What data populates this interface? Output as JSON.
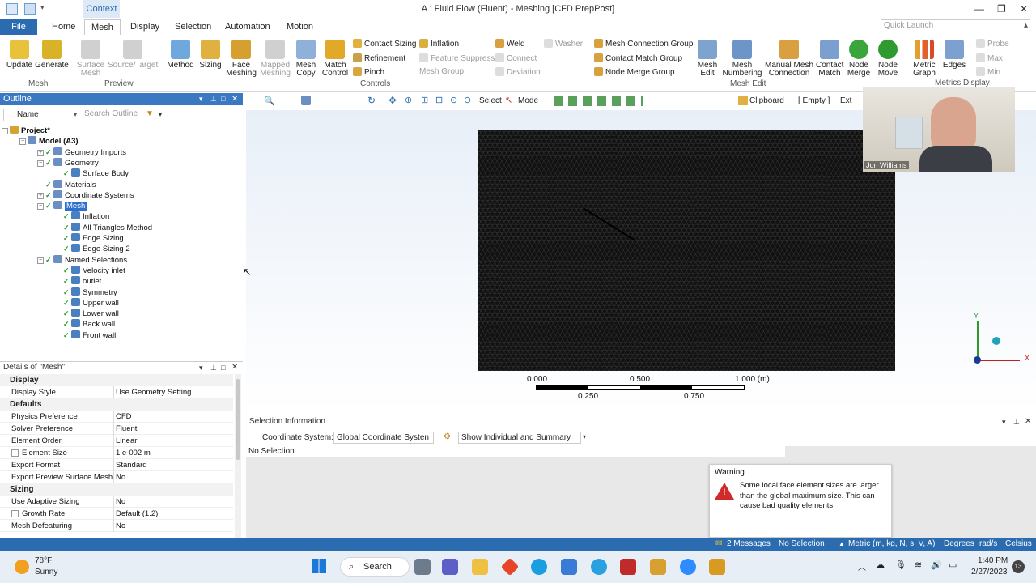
{
  "window": {
    "title": "A : Fluid Flow (Fluent) - Meshing [CFD PrepPost]",
    "context_tab": "Context"
  },
  "menu": {
    "tabs": [
      "File",
      "Home",
      "Mesh",
      "Display",
      "Selection",
      "Automation",
      "Motion"
    ],
    "quick_launch_placeholder": "Quick Launch"
  },
  "ribbon": {
    "mesh_group": {
      "label": "Mesh",
      "update": "Update",
      "generate": "Generate"
    },
    "preview_group": {
      "label": "Preview",
      "surface_mesh": "Surface Mesh",
      "source_target": "Source/Target"
    },
    "controls_group": {
      "label": "Controls",
      "method": "Method",
      "sizing": "Sizing",
      "face_meshing": "Face Meshing",
      "mapped_meshing": "Mapped Meshing",
      "mesh_copy": "Mesh Copy",
      "match_control": "Match Control",
      "contact_sizing": "Contact Sizing",
      "refinement": "Refinement",
      "pinch": "Pinch",
      "inflation": "Inflation",
      "feature_suppress": "Feature Suppress",
      "mesh_group": "Mesh Group",
      "weld": "Weld",
      "connect": "Connect",
      "deviation": "Deviation",
      "washer": "Washer"
    },
    "mesh_edit_group": {
      "label": "Mesh Edit",
      "mesh_connection_group": "Mesh Connection Group",
      "contact_match_group": "Contact Match Group",
      "node_merge_group": "Node Merge Group",
      "mesh_edit": "Mesh Edit",
      "mesh_numbering": "Mesh Numbering",
      "manual_mesh_connection": "Manual Mesh Connection",
      "contact_match": "Contact Match",
      "node_merge": "Node Merge",
      "node_move": "Node Move"
    },
    "metrics_group": {
      "label": "Metrics Display",
      "metric_graph": "Metric Graph",
      "edges": "Edges",
      "probe": "Probe",
      "max": "Max",
      "min": "Min"
    }
  },
  "outline": {
    "title": "Outline",
    "name_label": "Name",
    "search_placeholder": "Search Outline",
    "tree": [
      {
        "label": "Project*",
        "level": 0
      },
      {
        "label": "Model (A3)",
        "level": 1
      },
      {
        "label": "Geometry Imports",
        "level": 2
      },
      {
        "label": "Geometry",
        "level": 2
      },
      {
        "label": "Surface Body",
        "level": 3
      },
      {
        "label": "Materials",
        "level": 2
      },
      {
        "label": "Coordinate Systems",
        "level": 2
      },
      {
        "label": "Mesh",
        "level": 2,
        "selected": true
      },
      {
        "label": "Inflation",
        "level": 3
      },
      {
        "label": "All Triangles Method",
        "level": 3
      },
      {
        "label": "Edge Sizing",
        "level": 3
      },
      {
        "label": "Edge Sizing 2",
        "level": 3
      },
      {
        "label": "Named Selections",
        "level": 2
      },
      {
        "label": "Velocity inlet",
        "level": 3
      },
      {
        "label": "outlet",
        "level": 3
      },
      {
        "label": "Symmetry",
        "level": 3
      },
      {
        "label": "Upper wall",
        "level": 3
      },
      {
        "label": "Lower wall",
        "level": 3
      },
      {
        "label": "Back wall",
        "level": 3
      },
      {
        "label": "Front wall",
        "level": 3
      }
    ]
  },
  "details": {
    "title": "Details of \"Mesh\"",
    "rows": [
      {
        "type": "section",
        "label": "Display"
      },
      {
        "k": "Display Style",
        "v": "Use Geometry Setting"
      },
      {
        "type": "section",
        "label": "Defaults"
      },
      {
        "k": "Physics Preference",
        "v": "CFD"
      },
      {
        "k": "Solver Preference",
        "v": "Fluent"
      },
      {
        "k": "Element Order",
        "v": "Linear"
      },
      {
        "k": "Element Size",
        "v": "1.e-002 m",
        "indent": true
      },
      {
        "k": "Export Format",
        "v": "Standard"
      },
      {
        "k": "Export Preview Surface Mesh",
        "v": "No"
      },
      {
        "type": "section",
        "label": "Sizing"
      },
      {
        "k": "Use Adaptive Sizing",
        "v": "No"
      },
      {
        "k": "Growth Rate",
        "v": "Default (1.2)",
        "indent": true
      },
      {
        "k": "Mesh Defeaturing",
        "v": "No"
      }
    ]
  },
  "viewport_toolbar": {
    "select": "Select",
    "mode": "Mode",
    "clipboard": "Clipboard",
    "empty": "[ Empty ]",
    "ext": "Ext"
  },
  "scale": {
    "labels_top": [
      "0.000",
      "0.500",
      "1.000 (m)"
    ],
    "labels_bottom": [
      "0.250",
      "0.750"
    ]
  },
  "webcam": {
    "name": "Jon Williams"
  },
  "selection_info": {
    "title": "Selection Information",
    "coord_label": "Coordinate System:",
    "coord_value": "Global Coordinate Systen",
    "show_value": "Show Individual and Summary",
    "no_selection": "No Selection"
  },
  "warning": {
    "title": "Warning",
    "message": "Some local face element sizes are larger than the global maximum size. This can cause bad quality elements."
  },
  "status": {
    "messages": "2 Messages",
    "selection": "No Selection",
    "units": "Metric (m, kg, N, s, V, A)",
    "degrees": "Degrees",
    "rads": "rad/s",
    "temp": "Celsius"
  },
  "taskbar": {
    "temp": "78°F",
    "weather": "Sunny",
    "search": "Search",
    "time": "1:40 PM",
    "date": "2/27/2023",
    "notif": "13"
  }
}
